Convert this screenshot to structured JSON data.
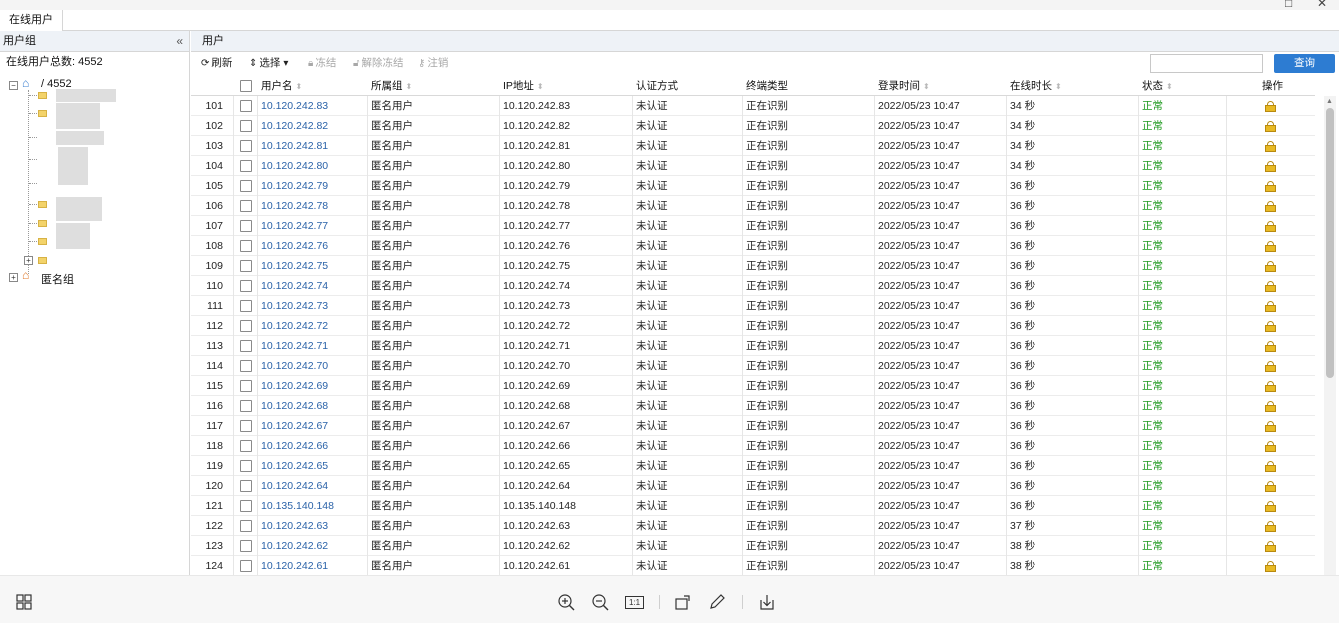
{
  "tab": {
    "label": "在线用户"
  },
  "left_panel": {
    "title": "用户组",
    "collapse_icon": "double-chevron-left-icon",
    "total_label": "在线用户总数:",
    "total_value": "4552",
    "tree": {
      "root_label": "/ 4552",
      "anonymous_group_label": "匿名组"
    }
  },
  "right_panel": {
    "title": "用户",
    "toolbar": {
      "refresh_label": "刷新",
      "select_label": "选择",
      "freeze_label": "冻结",
      "unfreeze_label": "解除冻结",
      "logout_label": "注销",
      "search_placeholder": "",
      "search_button_label": "查询"
    },
    "columns": {
      "username": "用户名",
      "group": "所属组",
      "ip": "IP地址",
      "auth": "认证方式",
      "terminal": "终端类型",
      "login_time": "登录时间",
      "online_duration": "在线时长",
      "status": "状态",
      "action": "操作"
    },
    "rows": [
      {
        "no": "101",
        "user": "10.120.242.83",
        "group": "匿名用户",
        "ip": "10.120.242.83",
        "auth": "未认证",
        "terminal": "正在识别",
        "login": "2022/05/23 10:47",
        "duration": "34 秒",
        "status": "正常"
      },
      {
        "no": "102",
        "user": "10.120.242.82",
        "group": "匿名用户",
        "ip": "10.120.242.82",
        "auth": "未认证",
        "terminal": "正在识别",
        "login": "2022/05/23 10:47",
        "duration": "34 秒",
        "status": "正常"
      },
      {
        "no": "103",
        "user": "10.120.242.81",
        "group": "匿名用户",
        "ip": "10.120.242.81",
        "auth": "未认证",
        "terminal": "正在识别",
        "login": "2022/05/23 10:47",
        "duration": "34 秒",
        "status": "正常"
      },
      {
        "no": "104",
        "user": "10.120.242.80",
        "group": "匿名用户",
        "ip": "10.120.242.80",
        "auth": "未认证",
        "terminal": "正在识别",
        "login": "2022/05/23 10:47",
        "duration": "34 秒",
        "status": "正常"
      },
      {
        "no": "105",
        "user": "10.120.242.79",
        "group": "匿名用户",
        "ip": "10.120.242.79",
        "auth": "未认证",
        "terminal": "正在识别",
        "login": "2022/05/23 10:47",
        "duration": "36 秒",
        "status": "正常"
      },
      {
        "no": "106",
        "user": "10.120.242.78",
        "group": "匿名用户",
        "ip": "10.120.242.78",
        "auth": "未认证",
        "terminal": "正在识别",
        "login": "2022/05/23 10:47",
        "duration": "36 秒",
        "status": "正常"
      },
      {
        "no": "107",
        "user": "10.120.242.77",
        "group": "匿名用户",
        "ip": "10.120.242.77",
        "auth": "未认证",
        "terminal": "正在识别",
        "login": "2022/05/23 10:47",
        "duration": "36 秒",
        "status": "正常"
      },
      {
        "no": "108",
        "user": "10.120.242.76",
        "group": "匿名用户",
        "ip": "10.120.242.76",
        "auth": "未认证",
        "terminal": "正在识别",
        "login": "2022/05/23 10:47",
        "duration": "36 秒",
        "status": "正常"
      },
      {
        "no": "109",
        "user": "10.120.242.75",
        "group": "匿名用户",
        "ip": "10.120.242.75",
        "auth": "未认证",
        "terminal": "正在识别",
        "login": "2022/05/23 10:47",
        "duration": "36 秒",
        "status": "正常"
      },
      {
        "no": "110",
        "user": "10.120.242.74",
        "group": "匿名用户",
        "ip": "10.120.242.74",
        "auth": "未认证",
        "terminal": "正在识别",
        "login": "2022/05/23 10:47",
        "duration": "36 秒",
        "status": "正常"
      },
      {
        "no": "111",
        "user": "10.120.242.73",
        "group": "匿名用户",
        "ip": "10.120.242.73",
        "auth": "未认证",
        "terminal": "正在识别",
        "login": "2022/05/23 10:47",
        "duration": "36 秒",
        "status": "正常"
      },
      {
        "no": "112",
        "user": "10.120.242.72",
        "group": "匿名用户",
        "ip": "10.120.242.72",
        "auth": "未认证",
        "terminal": "正在识别",
        "login": "2022/05/23 10:47",
        "duration": "36 秒",
        "status": "正常"
      },
      {
        "no": "113",
        "user": "10.120.242.71",
        "group": "匿名用户",
        "ip": "10.120.242.71",
        "auth": "未认证",
        "terminal": "正在识别",
        "login": "2022/05/23 10:47",
        "duration": "36 秒",
        "status": "正常"
      },
      {
        "no": "114",
        "user": "10.120.242.70",
        "group": "匿名用户",
        "ip": "10.120.242.70",
        "auth": "未认证",
        "terminal": "正在识别",
        "login": "2022/05/23 10:47",
        "duration": "36 秒",
        "status": "正常"
      },
      {
        "no": "115",
        "user": "10.120.242.69",
        "group": "匿名用户",
        "ip": "10.120.242.69",
        "auth": "未认证",
        "terminal": "正在识别",
        "login": "2022/05/23 10:47",
        "duration": "36 秒",
        "status": "正常"
      },
      {
        "no": "116",
        "user": "10.120.242.68",
        "group": "匿名用户",
        "ip": "10.120.242.68",
        "auth": "未认证",
        "terminal": "正在识别",
        "login": "2022/05/23 10:47",
        "duration": "36 秒",
        "status": "正常"
      },
      {
        "no": "117",
        "user": "10.120.242.67",
        "group": "匿名用户",
        "ip": "10.120.242.67",
        "auth": "未认证",
        "terminal": "正在识别",
        "login": "2022/05/23 10:47",
        "duration": "36 秒",
        "status": "正常"
      },
      {
        "no": "118",
        "user": "10.120.242.66",
        "group": "匿名用户",
        "ip": "10.120.242.66",
        "auth": "未认证",
        "terminal": "正在识别",
        "login": "2022/05/23 10:47",
        "duration": "36 秒",
        "status": "正常"
      },
      {
        "no": "119",
        "user": "10.120.242.65",
        "group": "匿名用户",
        "ip": "10.120.242.65",
        "auth": "未认证",
        "terminal": "正在识别",
        "login": "2022/05/23 10:47",
        "duration": "36 秒",
        "status": "正常"
      },
      {
        "no": "120",
        "user": "10.120.242.64",
        "group": "匿名用户",
        "ip": "10.120.242.64",
        "auth": "未认证",
        "terminal": "正在识别",
        "login": "2022/05/23 10:47",
        "duration": "36 秒",
        "status": "正常"
      },
      {
        "no": "121",
        "user": "10.135.140.148",
        "group": "匿名用户",
        "ip": "10.135.140.148",
        "auth": "未认证",
        "terminal": "正在识别",
        "login": "2022/05/23 10:47",
        "duration": "36 秒",
        "status": "正常"
      },
      {
        "no": "122",
        "user": "10.120.242.63",
        "group": "匿名用户",
        "ip": "10.120.242.63",
        "auth": "未认证",
        "terminal": "正在识别",
        "login": "2022/05/23 10:47",
        "duration": "37 秒",
        "status": "正常"
      },
      {
        "no": "123",
        "user": "10.120.242.62",
        "group": "匿名用户",
        "ip": "10.120.242.62",
        "auth": "未认证",
        "terminal": "正在识别",
        "login": "2022/05/23 10:47",
        "duration": "38 秒",
        "status": "正常"
      },
      {
        "no": "124",
        "user": "10.120.242.61",
        "group": "匿名用户",
        "ip": "10.120.242.61",
        "auth": "未认证",
        "terminal": "正在识别",
        "login": "2022/05/23 10:47",
        "duration": "38 秒",
        "status": "正常"
      }
    ]
  },
  "viewer_bar": {
    "icons": [
      "grid-view-icon",
      "zoom-in-icon",
      "zoom-out-icon",
      "actual-size-icon",
      "rotate-icon",
      "edit-pen-icon",
      "download-icon"
    ],
    "actual_size_label": "1:1"
  },
  "colors": {
    "link": "#2a62a8",
    "status_ok": "#1e9a1e",
    "search_button": "#2d7cd2",
    "panel_header_bg": "#eef2f7"
  }
}
